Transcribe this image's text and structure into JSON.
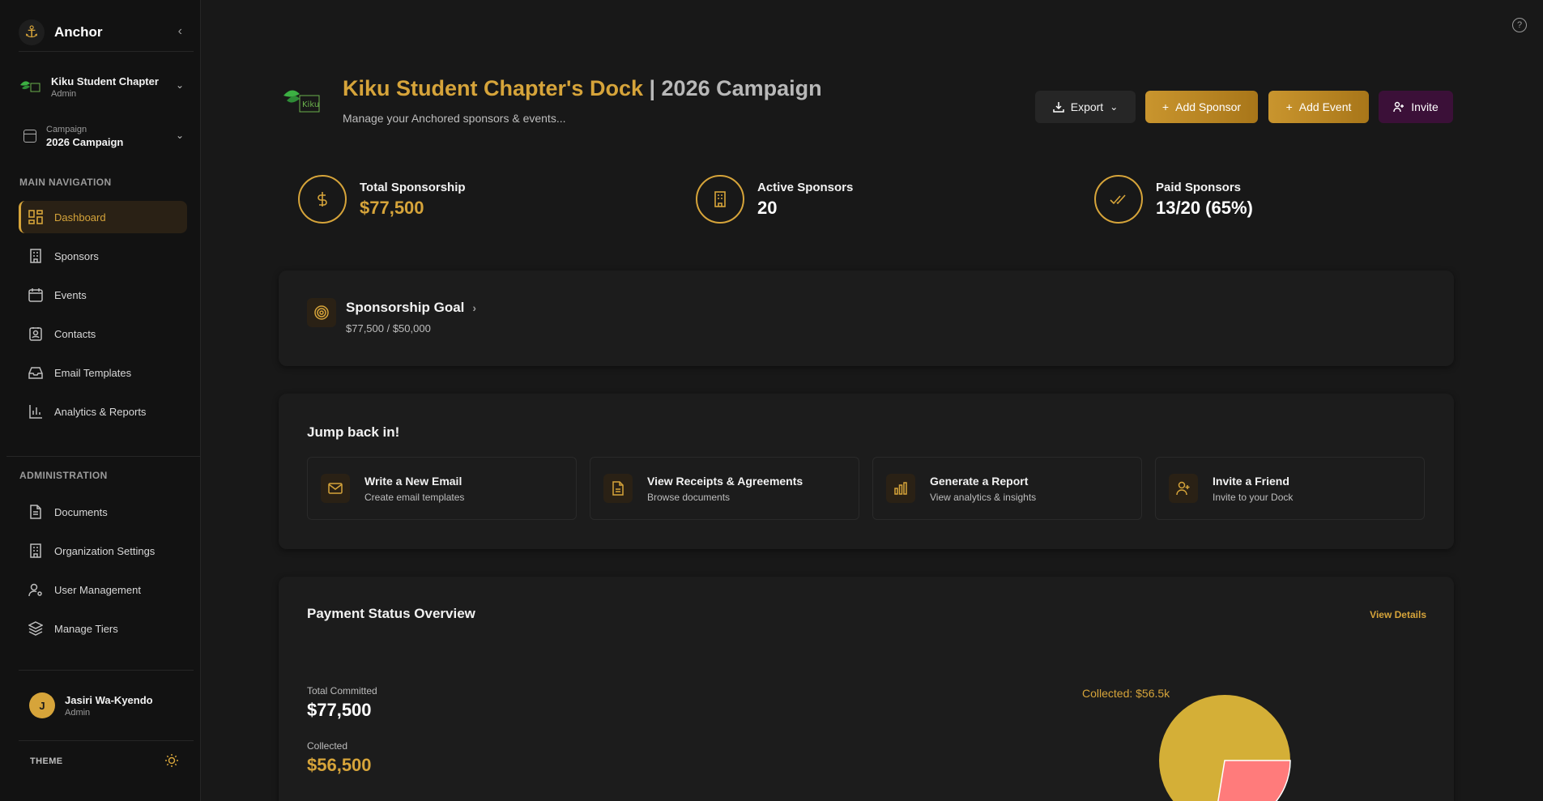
{
  "app": {
    "name": "Anchor"
  },
  "org": {
    "name": "Kiku Student Chapter",
    "role": "Admin"
  },
  "campaign": {
    "label": "Campaign",
    "name": "2026 Campaign"
  },
  "nav": {
    "main_label": "MAIN NAVIGATION",
    "items": [
      {
        "label": "Dashboard",
        "icon": "dashboard-icon",
        "active": true
      },
      {
        "label": "Sponsors",
        "icon": "building-icon"
      },
      {
        "label": "Events",
        "icon": "calendar-icon"
      },
      {
        "label": "Contacts",
        "icon": "contact-card-icon"
      },
      {
        "label": "Email Templates",
        "icon": "inbox-icon"
      },
      {
        "label": "Analytics & Reports",
        "icon": "bar-chart-icon"
      }
    ],
    "admin_label": "ADMINISTRATION",
    "admin_items": [
      {
        "label": "Documents",
        "icon": "document-icon"
      },
      {
        "label": "Organization Settings",
        "icon": "building-icon"
      },
      {
        "label": "User Management",
        "icon": "user-gear-icon"
      },
      {
        "label": "Manage Tiers",
        "icon": "layers-icon"
      }
    ]
  },
  "user": {
    "initial": "J",
    "name": "Jasiri Wa-Kyendo",
    "role": "Admin"
  },
  "theme": {
    "label": "THEME"
  },
  "header": {
    "title_accent": "Kiku Student Chapter's Dock",
    "title_rest": " | 2026 Campaign",
    "subtitle": "Manage your Anchored sponsors & events...",
    "buttons": {
      "export": "Export",
      "add_sponsor": "Add Sponsor",
      "add_event": "Add Event",
      "invite": "Invite"
    }
  },
  "stats": [
    {
      "label": "Total Sponsorship",
      "value": "$77,500"
    },
    {
      "label": "Active Sponsors",
      "value": "20"
    },
    {
      "label": "Paid Sponsors",
      "value": "13/20 (65%)"
    }
  ],
  "goal": {
    "title": "Sponsorship Goal",
    "progress": "$77,500 / $50,000"
  },
  "jump": {
    "title": "Jump back in!",
    "items": [
      {
        "title": "Write a New Email",
        "sub": "Create email templates"
      },
      {
        "title": "View Receipts & Agreements",
        "sub": "Browse documents"
      },
      {
        "title": "Generate a Report",
        "sub": "View analytics & insights"
      },
      {
        "title": "Invite a Friend",
        "sub": "Invite to your Dock"
      }
    ]
  },
  "payment": {
    "title": "Payment Status Overview",
    "view_details": "View Details",
    "total_committed_label": "Total Committed",
    "total_committed": "$77,500",
    "collected_label": "Collected",
    "collected": "$56,500",
    "pie_label": "Collected: $56.5k"
  },
  "colors": {
    "accent": "#d6a43a",
    "background": "#181818",
    "sidebar": "#121212",
    "card": "#1c1c1c",
    "invite": "#3b1038",
    "outstanding": "#ff7b7b"
  }
}
